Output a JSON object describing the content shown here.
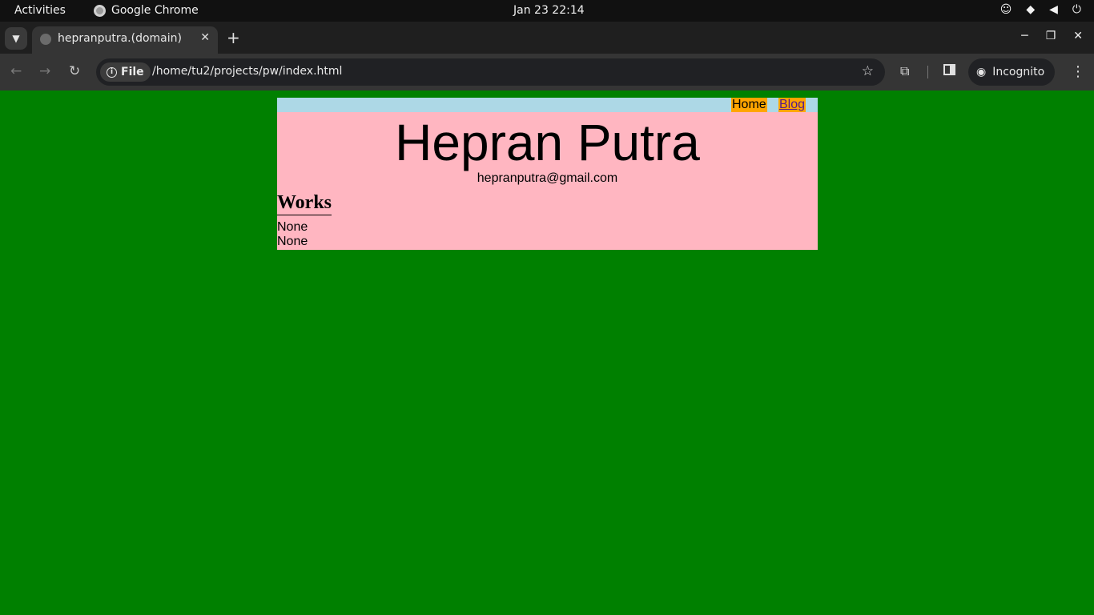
{
  "os": {
    "activities_label": "Activities",
    "app_name": "Google Chrome",
    "clock": "Jan 23  22:14",
    "tray_icons": [
      "accessibility-icon",
      "wifi-icon",
      "volume-icon",
      "power-icon"
    ]
  },
  "browser": {
    "tab_title": "hepranputra.(domain)",
    "new_tab_symbol": "+",
    "tab_close_symbol": "✕",
    "chip_label": "File",
    "url": "/home/tu2/projects/pw/index.html",
    "incognito_label": "Incognito"
  },
  "site": {
    "nav": {
      "home_label": "Home",
      "blog_label": "Blog"
    },
    "name": "Hepran Putra",
    "email": "hepranputra@gmail.com",
    "section_heading": "Works",
    "works": [
      "None",
      "None"
    ],
    "colors": {
      "body_background": "#008000",
      "page_background": "#ffb6c1",
      "navbar_background": "#add8e6",
      "nav_link_background": "#ffa500"
    }
  }
}
